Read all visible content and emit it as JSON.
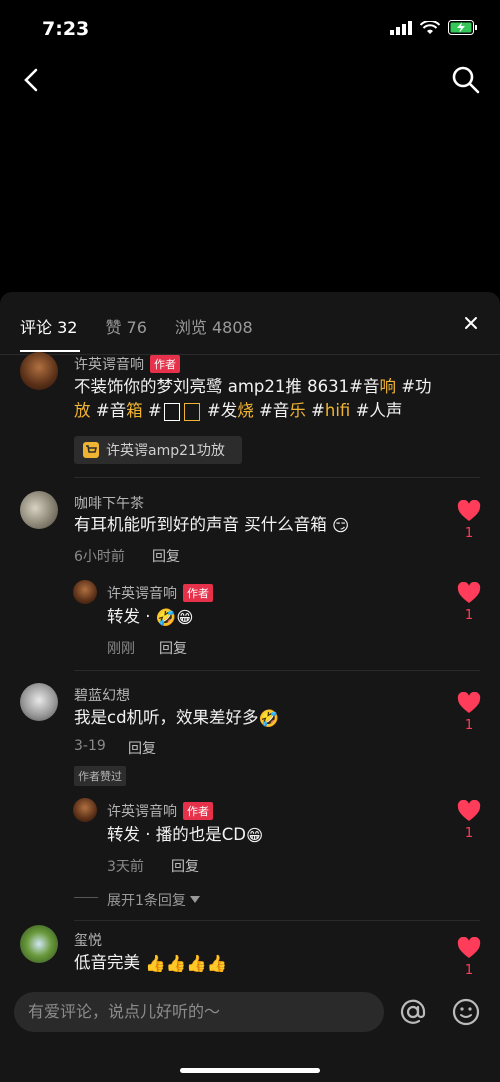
{
  "status": {
    "time": "7:23"
  },
  "tabs": [
    {
      "label": "评论 32",
      "active": true
    },
    {
      "label": "赞 76",
      "active": false
    },
    {
      "label": "浏览 4808",
      "active": false
    }
  ],
  "post": {
    "author": "许英谔音响",
    "badge": "作者",
    "line1_a": "不装饰你的梦刘亮鹭 amp21推 8631#音",
    "line1_b": "响",
    "line1_c": " #功",
    "line2_a": "放",
    "line2_b": " #音",
    "line2_c": "箱",
    "line2_d": " #",
    "line2_e": " #发",
    "line2_f": "烧",
    "line2_g": " #音",
    "line2_h": "乐",
    "line2_i": " #",
    "line2_j": "hifi",
    "line2_k": " #人声",
    "product": "许英谔amp21功放"
  },
  "comments": [
    {
      "name": "咖啡下午茶",
      "text": "有耳机能听到好的声音 买什么音箱",
      "time": "6小时前",
      "reply": "回复",
      "likes": "1"
    },
    {
      "name": "许英谔音响",
      "badge": "作者",
      "text": "转发 · ",
      "time": "刚刚",
      "reply": "回复",
      "likes": "1"
    },
    {
      "name": "碧蓝幻想",
      "text": "我是cd机听，效果差好多",
      "time": "3-19",
      "reply": "回复",
      "likes": "1",
      "tag": "作者赞过"
    },
    {
      "name": "许英谔音响",
      "badge": "作者",
      "text": "转发 · 播的也是CD",
      "time": "3天前",
      "reply": "回复",
      "likes": "1"
    },
    {
      "name": "玺悦",
      "text": "低音完美",
      "likes": "1"
    }
  ],
  "expand": "展开1条回复",
  "input": {
    "placeholder": "有爱评论，说点儿好听的～"
  },
  "colors": {
    "accent": "#f0b433",
    "like": "#ff3d5a",
    "badge": "#e6314a"
  }
}
